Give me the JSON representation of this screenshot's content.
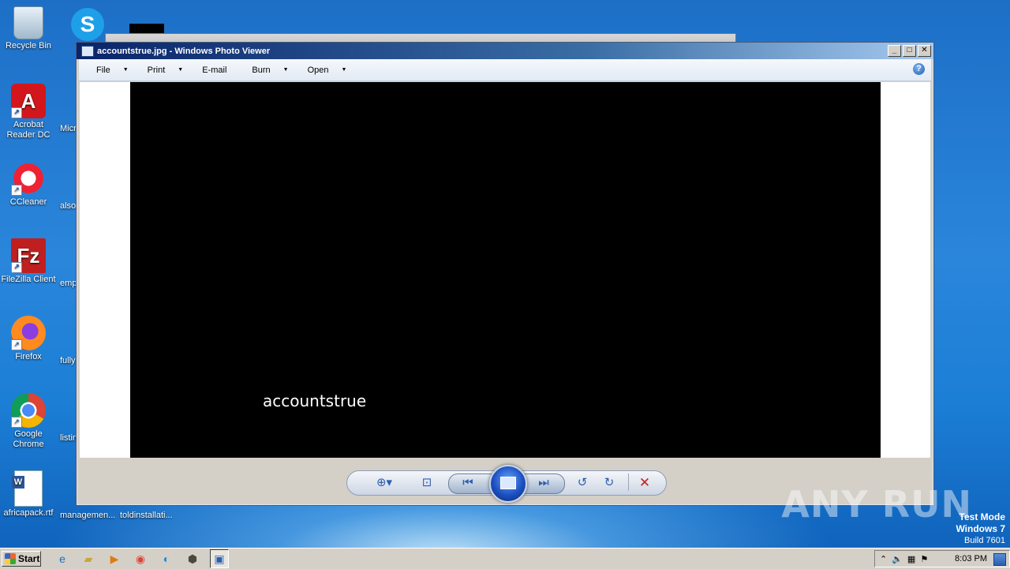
{
  "desktop": {
    "icons": [
      {
        "label": "Recycle Bin",
        "icon": "recycle-bin-icon"
      },
      {
        "label": "Acrobat Reader DC",
        "icon": "acrobat-icon"
      },
      {
        "label": "CCleaner",
        "icon": "ccleaner-icon"
      },
      {
        "label": "FileZilla Client",
        "icon": "filezilla-icon"
      },
      {
        "label": "Firefox",
        "icon": "firefox-icon"
      },
      {
        "label": "Google Chrome",
        "icon": "chrome-icon"
      },
      {
        "label": "africapack.rtf",
        "icon": "word-doc-icon"
      }
    ],
    "partial_labels": [
      "Micr",
      "also",
      "emp",
      "fully",
      "listin",
      "managemen...",
      "toldinstallati..."
    ]
  },
  "window": {
    "title": "accountstrue.jpg - Windows Photo Viewer",
    "menu": [
      "File",
      "Print",
      "E-mail",
      "Burn",
      "Open"
    ],
    "help": "?",
    "image_caption": "accountstrue"
  },
  "controls": {
    "zoom": "zoom-icon",
    "fit": "fit-window-icon",
    "prev": "previous-icon",
    "slideshow": "slideshow-icon",
    "next": "next-icon",
    "rotate_ccw": "rotate-counterclockwise-icon",
    "rotate_cw": "rotate-clockwise-icon",
    "delete": "delete-icon"
  },
  "taskbar": {
    "start_label": "Start",
    "clock": "8:03 PM"
  },
  "watermark": "ANY RUN",
  "test_mode": {
    "line1": "Test Mode",
    "line2": "Windows 7",
    "line3": "Build 7601"
  }
}
